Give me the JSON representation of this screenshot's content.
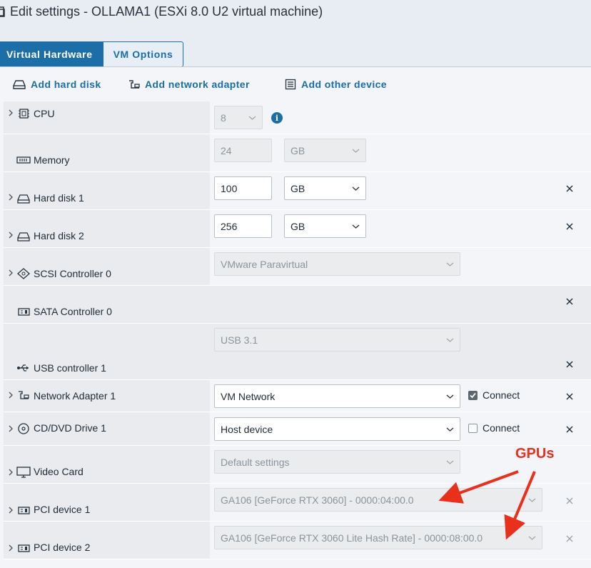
{
  "window": {
    "title": "Edit settings - OLLAMA1 (ESXi 8.0 U2 virtual machine)"
  },
  "tabs": [
    {
      "label": "Virtual Hardware",
      "active": true
    },
    {
      "label": "VM Options",
      "active": false
    }
  ],
  "toolbar": {
    "add_hard_disk": "Add hard disk",
    "add_network_adapter": "Add network adapter",
    "add_other_device": "Add other device"
  },
  "devices": {
    "cpu": {
      "name": "CPU",
      "value": "8"
    },
    "memory": {
      "name": "Memory",
      "value": "24",
      "unit": "GB"
    },
    "hard_disk_1": {
      "name": "Hard disk 1",
      "value": "100",
      "unit": "GB"
    },
    "hard_disk_2": {
      "name": "Hard disk 2",
      "value": "256",
      "unit": "GB"
    },
    "scsi": {
      "name": "SCSI Controller 0",
      "value": "VMware Paravirtual"
    },
    "sata": {
      "name": "SATA Controller 0"
    },
    "usb": {
      "name": "USB controller 1",
      "value": "USB 3.1"
    },
    "network": {
      "name": "Network Adapter 1",
      "value": "VM Network",
      "connect_label": "Connect",
      "connected": true
    },
    "cdrom": {
      "name": "CD/DVD Drive 1",
      "value": "Host device",
      "connect_label": "Connect",
      "connected": false
    },
    "video": {
      "name": "Video Card",
      "value": "Default settings"
    },
    "pci_1": {
      "name": "PCI device 1",
      "value": "GA106 [GeForce RTX 3060] - 0000:04:00.0"
    },
    "pci_2": {
      "name": "PCI device 2",
      "value": "GA106 [GeForce RTX 3060 Lite Hash Rate] - 0000:08:00.0"
    }
  },
  "annotation": {
    "label": "GPUs",
    "color": "#e8301c"
  },
  "colors": {
    "accent": "#1b6ea8"
  }
}
